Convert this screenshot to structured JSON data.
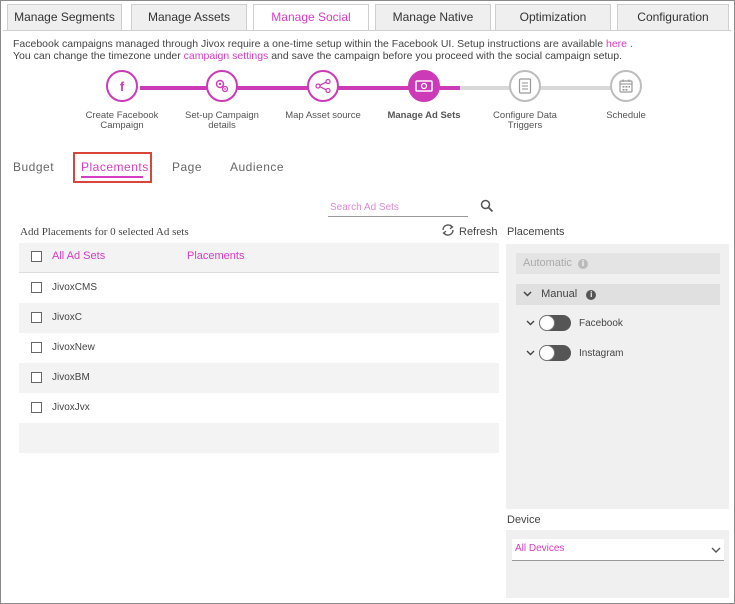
{
  "top_tabs": [
    {
      "label": "Manage Segments"
    },
    {
      "label": "Manage Assets"
    },
    {
      "label": "Manage Social"
    },
    {
      "label": "Manage Native"
    },
    {
      "label": "Optimization"
    },
    {
      "label": "Configuration"
    }
  ],
  "info": {
    "line1_pre": "Facebook campaigns managed through Jivox require a one-time setup within the Facebook UI. Setup instructions are available ",
    "line1_link": "here",
    "line1_post": " .",
    "line2_pre": "You can change the timezone under ",
    "line2_link": "campaign settings",
    "line2_post": " and save the campaign before you proceed with the social campaign setup."
  },
  "steps": [
    {
      "label": "Create Facebook Campaign",
      "icon": "facebook-icon"
    },
    {
      "label": "Set-up Campaign details",
      "icon": "settings-people-icon"
    },
    {
      "label": "Map Asset source",
      "icon": "network-icon"
    },
    {
      "label": "Manage Ad Sets",
      "icon": "money-icon"
    },
    {
      "label": "Configure Data Triggers",
      "icon": "list-icon"
    },
    {
      "label": "Schedule",
      "icon": "calendar-icon"
    }
  ],
  "sub_tabs": [
    {
      "label": "Budget"
    },
    {
      "label": "Placements"
    },
    {
      "label": "Page"
    },
    {
      "label": "Audience"
    }
  ],
  "search": {
    "placeholder": "Search Ad Sets"
  },
  "add_label": "Add Placements for 0 selected Ad sets",
  "refresh_label": "Refresh",
  "table": {
    "headers": [
      "All Ad Sets",
      "Placements"
    ],
    "rows": [
      "JivoxCMS",
      "JivoxC",
      "JivoxNew",
      "JivoxBM",
      "JivoxJvx"
    ]
  },
  "placements": {
    "title": "Placements",
    "automatic": "Automatic",
    "manual": "Manual",
    "options": [
      "Facebook",
      "Instagram"
    ]
  },
  "device": {
    "title": "Device",
    "selected": "All Devices"
  },
  "colors": {
    "accent": "#d63cc4",
    "highlight_box": "#d9453a"
  }
}
